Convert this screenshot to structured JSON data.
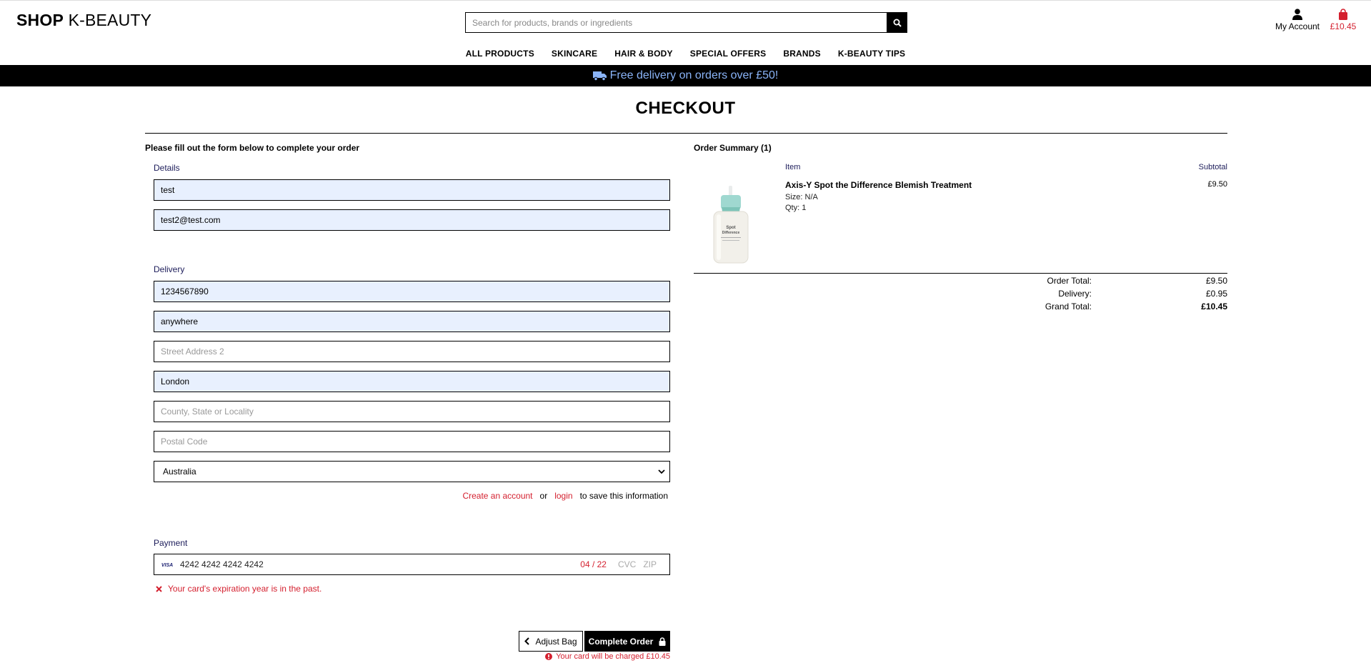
{
  "header": {
    "logo_bold": "SHOP",
    "logo_rest": " K-BEAUTY",
    "search_placeholder": "Search for products, brands or ingredients",
    "account_label": "My Account",
    "cart_total": "£10.45"
  },
  "nav": [
    "ALL PRODUCTS",
    "SKINCARE",
    "HAIR & BODY",
    "SPECIAL OFFERS",
    "BRANDS",
    "K-BEAUTY TIPS"
  ],
  "banner": {
    "text": "Free delivery on orders over £50!"
  },
  "page_title": "CHECKOUT",
  "form": {
    "intro": "Please fill out the form below to complete your order",
    "details_label": "Details",
    "full_name": "test",
    "email": "test2@test.com",
    "delivery_label": "Delivery",
    "phone": "1234567890",
    "street1": "anywhere",
    "street2_placeholder": "Street Address 2",
    "town": "London",
    "county_placeholder": "County, State or Locality",
    "postcode_placeholder": "Postal Code",
    "country": "Australia",
    "create_account": "Create an account",
    "or": "or",
    "login": "login",
    "save_suffix": "to save this information",
    "payment_label": "Payment",
    "card_brand": "VISA",
    "card_number": "4242 4242 4242 4242",
    "card_expiry": "04 / 22",
    "card_cvc": "CVC",
    "card_zip": "ZIP",
    "card_error": "Your card's expiration year is in the past.",
    "adjust_bag": "Adjust Bag",
    "complete_order": "Complete Order",
    "charge_note": "Your card will be charged £10.45"
  },
  "summary": {
    "title": "Order Summary (1)",
    "item_header": "Item",
    "subtotal_header": "Subtotal",
    "product_name": "Axis-Y Spot the Difference Blemish Treatment",
    "product_size": "Size: N/A",
    "product_qty": "Qty: 1",
    "product_price": "£9.50",
    "product_image_text": "Spot\nDifference",
    "order_total_label": "Order Total:",
    "order_total": "£9.50",
    "delivery_label": "Delivery:",
    "delivery": "£0.95",
    "grand_total_label": "Grand Total:",
    "grand_total": "£10.45"
  },
  "colors": {
    "accent_red": "#d4202f",
    "banner_text": "#8ab4f8",
    "autofill_bg": "#e8f0fe"
  },
  "icons": [
    "search-icon",
    "user-icon",
    "bag-icon",
    "truck-icon",
    "chevron-down-icon",
    "visa-icon",
    "error-x-icon",
    "chevron-left-icon",
    "lock-icon",
    "alert-circle-icon"
  ]
}
